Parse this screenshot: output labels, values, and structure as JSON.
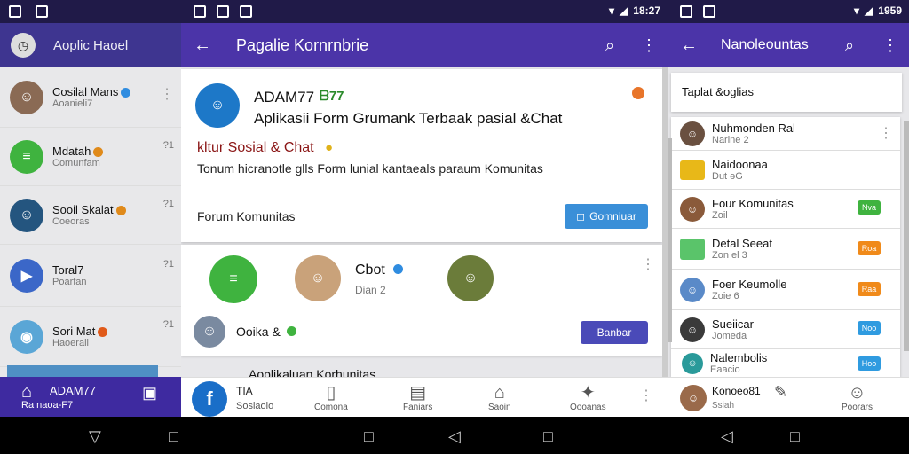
{
  "left": {
    "status_icons": [
      "notification-icon",
      "notification-icon"
    ],
    "title": "Aoplic Haoel",
    "contacts": [
      {
        "name": "Cosilal Mans",
        "sub": "Aoanieli7",
        "badge": "#2f8ce0"
      },
      {
        "name": "Mdatah",
        "sub": "Comunfam",
        "badge": "#e08a1a",
        "time": "?1"
      },
      {
        "name": "Sooil Skalat",
        "sub": "Coeoras",
        "badge": "#e08a1a",
        "time": "?1"
      },
      {
        "name": "Toral7",
        "sub": "Poarfan",
        "time": "?1"
      },
      {
        "name": "Sori Mat",
        "sub": "Haoeraii",
        "badge": "#e05a1a",
        "time": "?1"
      }
    ],
    "footer_title": "ADAM77",
    "footer_sub": "Ra naoa-F7"
  },
  "middle": {
    "title": "Pagalie Kornrnbrie",
    "profile_name": "ADAM77",
    "profile_mark": "ᗷ77",
    "headline": "Aplikasii Form Grumank Terbaak pasial &Chat",
    "subhead": "kltur Sosial & Chat",
    "desc": "Tonum hicranotle glls Form lunial kantaeals paraum Komunitas",
    "forum_label": "Forum Komunitas",
    "cta_label": "Gomniuar",
    "group_name": "Cbot",
    "group_sub": "Dian 2",
    "row_name": "Ooika &",
    "join_label": "Banbar",
    "partial_row": "Aoplikaluan Korhunitas",
    "bottom_nav": [
      {
        "icon": "facebook-icon",
        "label": "TIA",
        "sub": "Sosiaoio"
      },
      {
        "icon": "book-icon",
        "label": "Comona"
      },
      {
        "icon": "chat-icon",
        "label": "Faniars"
      },
      {
        "icon": "home-icon",
        "label": "Saoin"
      },
      {
        "icon": "share-icon",
        "label": "Oooanas"
      }
    ],
    "time": "18:27"
  },
  "right": {
    "title": "Nanoleountas",
    "tab_label": "Taplat &oglias",
    "items": [
      {
        "name": "Nuhmonden Ral",
        "sub": "Narine 2"
      },
      {
        "name": "Naidoonaa",
        "sub": "Dut ǝG"
      },
      {
        "name": "Four Komunitas",
        "sub": "Zoil",
        "tag": "Nva",
        "tagcolor": "#3fb33f"
      },
      {
        "name": "Detal Seeat",
        "sub": "Zon el 3",
        "tag": "Roa",
        "tagcolor": "#f08a1a"
      },
      {
        "name": "Foer Keumolle",
        "sub": "Zoie 6",
        "tag": "Raa",
        "tagcolor": "#f08a1a"
      },
      {
        "name": "Sueiicar",
        "sub": "Jomeda",
        "tag": "Noo",
        "tagcolor": "#2f9be0"
      },
      {
        "name": "Nalembolis",
        "sub": "Eaacio",
        "tag": "Hoo",
        "tagcolor": "#2f9be0"
      },
      {
        "name": "Konoeo81",
        "sub": "Ssiah"
      }
    ],
    "bottom_right_label": "Poorars",
    "time": "1959"
  }
}
